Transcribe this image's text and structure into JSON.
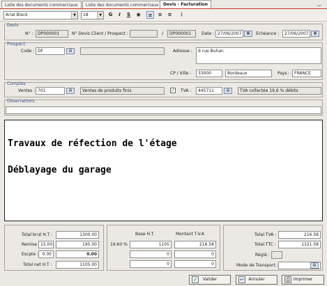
{
  "tabs": [
    {
      "label": "Liste des documents commerciaux"
    },
    {
      "label": "Liste des documents commerciaux"
    },
    {
      "label": "Devis - Facturation"
    }
  ],
  "toolbar": {
    "font": "Arial Black",
    "size": "18",
    "bold": "G",
    "italic": "I",
    "underline": "S"
  },
  "devis": {
    "title": "Devis",
    "num_label": "N° :",
    "num_value": "DP000001",
    "client_label": "N° Devis Client / Prospect :",
    "client_value": "",
    "slash": "/",
    "doc_value": "DP000001",
    "date_label": "Date :",
    "date_value": "27/06/2007",
    "echeance_label": "Echéance :",
    "echeance_value": "27/06/2007"
  },
  "prospect": {
    "title": "Prospect",
    "code_label": "Code :",
    "code_value": "DF",
    "name_value": "",
    "adresse_label": "Adresse :",
    "adresse_value": "9 rue Buhan",
    "cp_label": "CP / Ville :",
    "cp_value": "33000",
    "ville_value": "Bordeaux",
    "pays_label": "Pays :",
    "pays_value": "FRANCE"
  },
  "comptes": {
    "title": "Comptes",
    "ventes_label": "Ventes :",
    "ventes_code": "701",
    "ventes_desc": "Ventes de produits finis",
    "tva_label": "TVA :",
    "tva_code": "445711",
    "tva_desc": "TVA collectée 19,6 % débits"
  },
  "observations": {
    "title": "Observations",
    "value": ""
  },
  "editor": {
    "line1": "Travaux de réfection de l'étage",
    "line2": "Déblayage du garage"
  },
  "totals": {
    "brut_label": "Total brut H.T :",
    "brut_value": "1300.00",
    "remise_label": "Remise :",
    "remise_pct": "15.00",
    "remise_value": "195.00",
    "escpte_label": "Escpte :",
    "escpte_pct": "0.00",
    "escpte_value": "0.00",
    "net_label": "Total net H.T :",
    "net_value": "1105.00"
  },
  "tva_table": {
    "col_base": "Base H.T.",
    "col_montant": "Montant T.V.A",
    "rows": [
      {
        "rate": "19.60 %",
        "base": "1105",
        "montant": "216.58"
      },
      {
        "rate": "",
        "base": "0",
        "montant": "0"
      },
      {
        "rate": "",
        "base": "0",
        "montant": "0"
      }
    ]
  },
  "summary": {
    "tva_label": "Total TVA :",
    "tva_value": "216.58",
    "ttc_label": "Total TTC :",
    "ttc_value": "1321.58",
    "regle_label": "Réglé :",
    "transport_label": "Mode de Transport :"
  },
  "buttons": {
    "valider": "Valider",
    "annuler": "Annuler",
    "imprimer": "Imprimer"
  },
  "colors": {
    "accent": "#c0392b",
    "group_title": "#3a4d8f"
  }
}
